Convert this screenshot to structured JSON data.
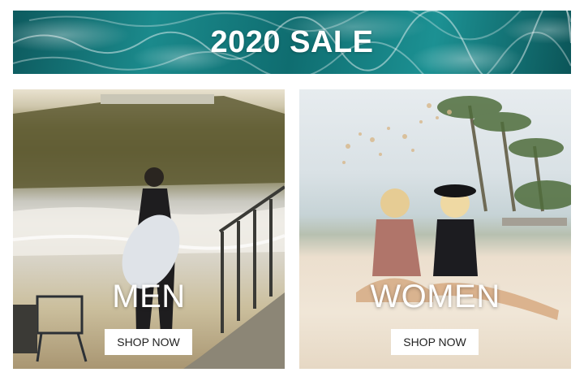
{
  "banner": {
    "title": "2020 SALE"
  },
  "categories": [
    {
      "title": "MEN",
      "button_label": "SHOP NOW"
    },
    {
      "title": "WOMEN",
      "button_label": "SHOP NOW"
    }
  ]
}
